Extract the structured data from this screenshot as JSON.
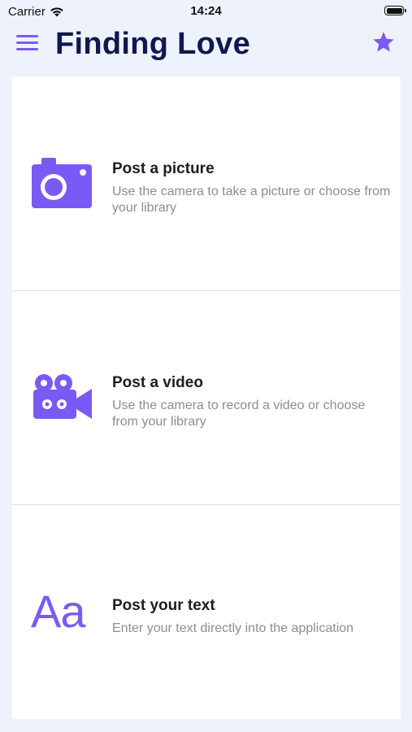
{
  "status_bar": {
    "carrier": "Carrier",
    "time": "14:24"
  },
  "nav": {
    "title": "Finding Love",
    "menu_icon": "hamburger-menu-icon",
    "favorite_icon": "star-icon"
  },
  "options": [
    {
      "title": "Post a picture",
      "description": "Use the camera to take a picture or choose from your library",
      "icon": "camera-icon"
    },
    {
      "title": "Post a video",
      "description": "Use the camera to record a video or choose from your library",
      "icon": "video-camera-icon"
    },
    {
      "title": "Post your text",
      "description": "Enter your text directly into the application",
      "icon": "text-icon",
      "icon_text": "Aa"
    }
  ],
  "colors": {
    "accent": "#7a5af5",
    "title": "#0f1850",
    "background": "#eef2fc",
    "card": "#ffffff",
    "secondary_text": "#8d8d93"
  }
}
